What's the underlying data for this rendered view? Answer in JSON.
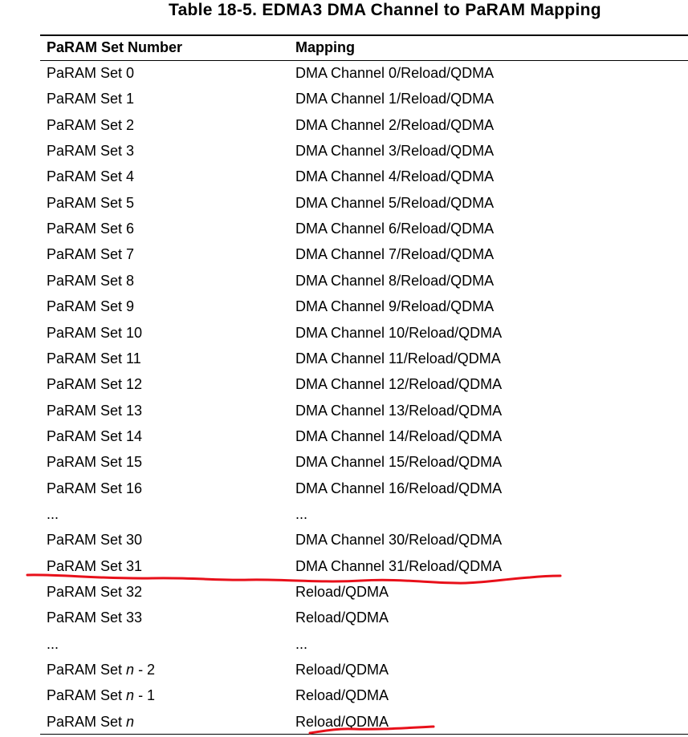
{
  "caption": "Table 18-5. EDMA3 DMA Channel to PaRAM Mapping",
  "headers": {
    "set": "PaRAM Set Number",
    "mapping": "Mapping"
  },
  "rows": [
    {
      "set": "PaRAM Set 0",
      "mapping": "DMA Channel 0/Reload/QDMA"
    },
    {
      "set": "PaRAM Set 1",
      "mapping": "DMA Channel 1/Reload/QDMA"
    },
    {
      "set": "PaRAM Set 2",
      "mapping": "DMA Channel 2/Reload/QDMA"
    },
    {
      "set": "PaRAM Set 3",
      "mapping": "DMA Channel 3/Reload/QDMA"
    },
    {
      "set": "PaRAM Set 4",
      "mapping": "DMA Channel 4/Reload/QDMA"
    },
    {
      "set": "PaRAM Set 5",
      "mapping": "DMA Channel 5/Reload/QDMA"
    },
    {
      "set": "PaRAM Set 6",
      "mapping": "DMA Channel 6/Reload/QDMA"
    },
    {
      "set": "PaRAM Set 7",
      "mapping": "DMA Channel 7/Reload/QDMA"
    },
    {
      "set": "PaRAM Set 8",
      "mapping": "DMA Channel 8/Reload/QDMA"
    },
    {
      "set": "PaRAM Set 9",
      "mapping": "DMA Channel 9/Reload/QDMA"
    },
    {
      "set": "PaRAM Set 10",
      "mapping": "DMA Channel 10/Reload/QDMA"
    },
    {
      "set": "PaRAM Set 11",
      "mapping": "DMA Channel 11/Reload/QDMA"
    },
    {
      "set": "PaRAM Set 12",
      "mapping": "DMA Channel 12/Reload/QDMA"
    },
    {
      "set": "PaRAM Set 13",
      "mapping": "DMA Channel 13/Reload/QDMA"
    },
    {
      "set": "PaRAM Set 14",
      "mapping": "DMA Channel 14/Reload/QDMA"
    },
    {
      "set": "PaRAM Set 15",
      "mapping": "DMA Channel 15/Reload/QDMA"
    },
    {
      "set": "PaRAM Set 16",
      "mapping": "DMA Channel 16/Reload/QDMA"
    },
    {
      "set": "...",
      "mapping": "..."
    },
    {
      "set": "PaRAM Set 30",
      "mapping": "DMA Channel 30/Reload/QDMA"
    },
    {
      "set": "PaRAM Set 31",
      "mapping": "DMA Channel 31/Reload/QDMA"
    },
    {
      "set": "PaRAM Set 32",
      "mapping": "Reload/QDMA"
    },
    {
      "set": "PaRAM Set 33",
      "mapping": "Reload/QDMA"
    },
    {
      "set": "...",
      "mapping": "..."
    }
  ],
  "var_rows": [
    {
      "prefix": "PaRAM Set ",
      "var": "n",
      "suffix": " - 2",
      "mapping": "Reload/QDMA"
    },
    {
      "prefix": "PaRAM Set ",
      "var": "n",
      "suffix": " - 1",
      "mapping": "Reload/QDMA"
    },
    {
      "prefix": "PaRAM Set ",
      "var": "n",
      "suffix": "",
      "mapping": "Reload/QDMA"
    }
  ],
  "annotation_color": "#e8101a"
}
